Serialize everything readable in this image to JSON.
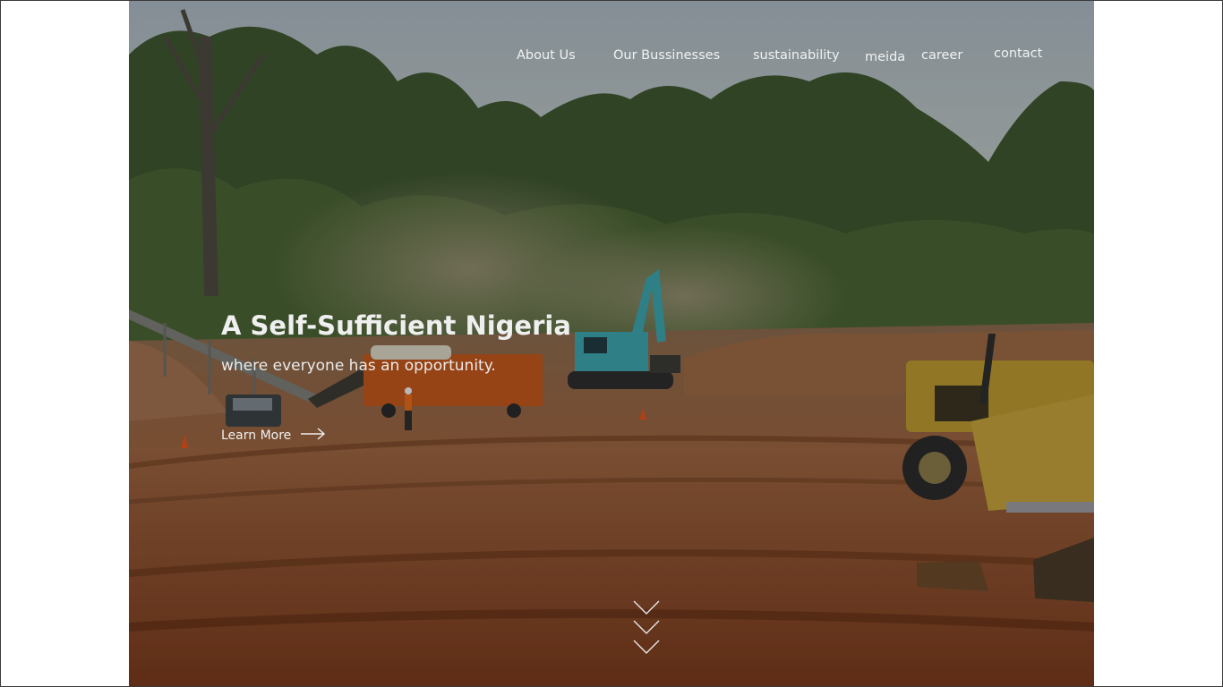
{
  "nav": {
    "items": [
      {
        "label": "About Us"
      },
      {
        "label": "Our Bussinesses"
      },
      {
        "label": "sustainability"
      },
      {
        "label": "meida"
      },
      {
        "label": "career"
      },
      {
        "label": "contact"
      }
    ]
  },
  "hero": {
    "title": "A Self-Sufficient Nigeria",
    "subtitle": "where everyone has an opportunity.",
    "cta_label": "Learn More",
    "cta_icon": "arrow-right-icon",
    "scroll_icon": "triple-chevron-down-icon"
  },
  "colors": {
    "nav_text": "#f2f2f2",
    "headline": "#efefef",
    "soil": "#9a5a32",
    "sky": "#b8c4cc",
    "foliage": "#3f5a2a"
  }
}
